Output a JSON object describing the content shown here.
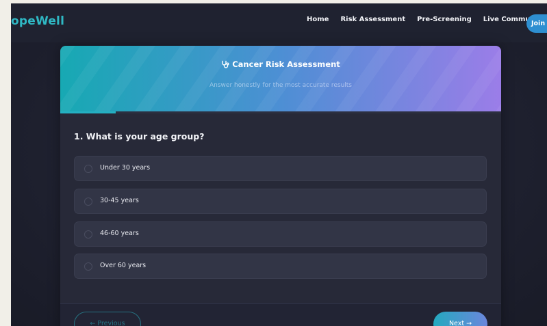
{
  "brand": {
    "name": "HopeWell",
    "visible_text": "opeWell"
  },
  "nav": {
    "links": [
      "Home",
      "Risk Assessment",
      "Pre-Screening",
      "Live Community"
    ],
    "join_label": "Join C"
  },
  "assessment": {
    "title": "Cancer Risk Assessment",
    "title_icon": "stethoscope-icon",
    "subtitle": "Answer honestly for the most accurate results",
    "progress_percent": 12.5,
    "question": "1. What is your age group?",
    "options": [
      "Under 30 years",
      "30-45 years",
      "46-60 years",
      "Over 60 years"
    ],
    "previous_label": "← Previous",
    "next_label": "Next →"
  },
  "colors": {
    "accent_teal": "#24b0c2",
    "accent_purple": "#9b7de8",
    "background": "#1f2130",
    "card": "#272938"
  }
}
